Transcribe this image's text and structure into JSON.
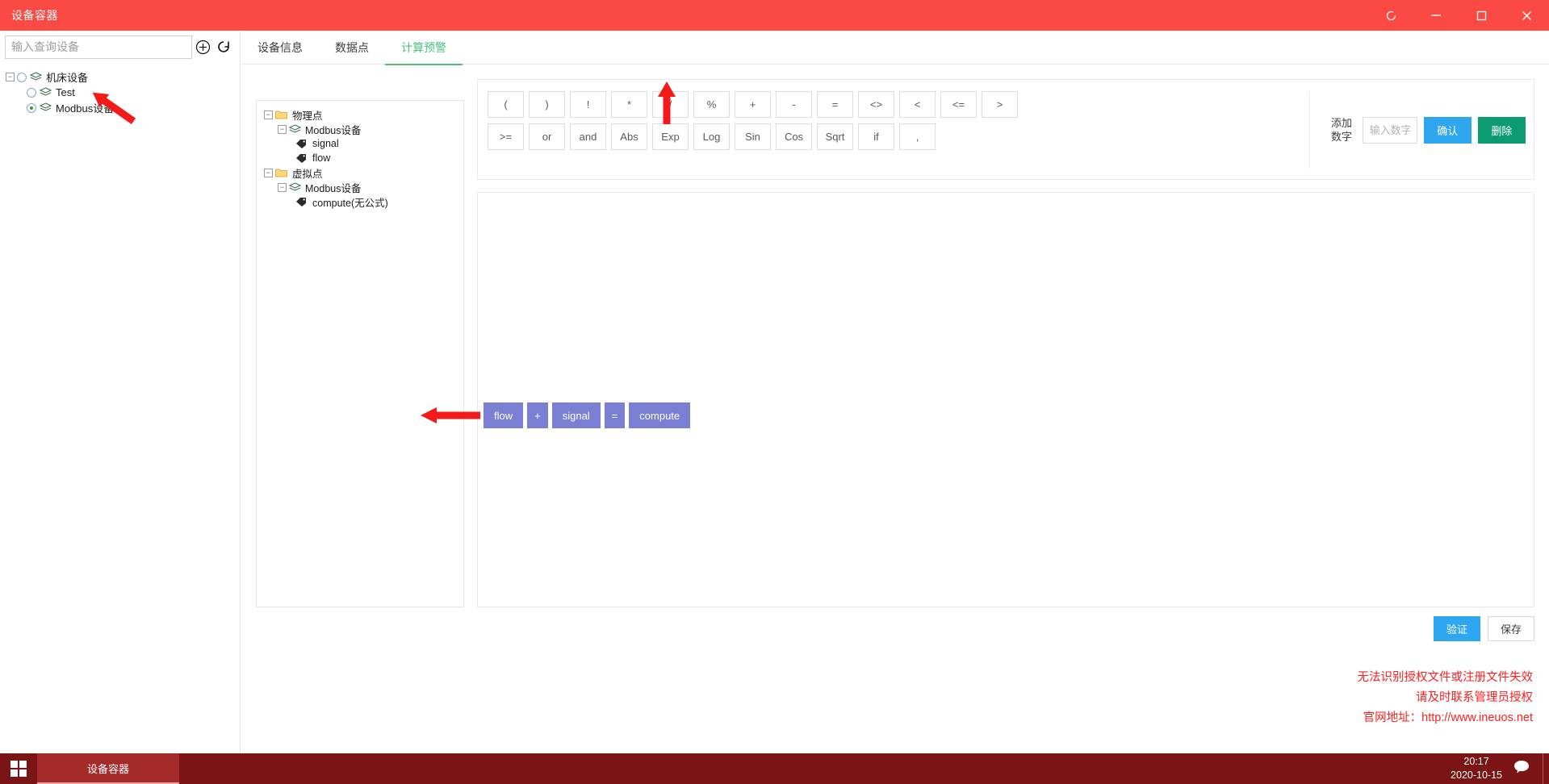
{
  "window": {
    "title": "设备容器",
    "controls": [
      {
        "name": "refresh-icon",
        "glyph": "◌"
      },
      {
        "name": "minimize-icon",
        "glyph": "—"
      },
      {
        "name": "maximize-icon",
        "glyph": "□"
      },
      {
        "name": "close-icon",
        "glyph": "✕"
      }
    ]
  },
  "sidebar": {
    "search_placeholder": "输入查询设备",
    "search_value": "",
    "add_icon": "plus-circle-icon",
    "refresh_icon": "refresh-icon",
    "tree": [
      {
        "label": "机床设备",
        "level": 0,
        "expander": "−",
        "radio": false,
        "icon": "layers-icon"
      },
      {
        "label": "Test",
        "level": 1,
        "expander": "",
        "radio": false,
        "icon": "layers-icon"
      },
      {
        "label": "Modbus设备",
        "level": 1,
        "expander": "",
        "radio": true,
        "icon": "layers-icon"
      }
    ]
  },
  "tabs": [
    {
      "label": "设备信息",
      "active": false
    },
    {
      "label": "数据点",
      "active": false
    },
    {
      "label": "计算预警",
      "active": true
    }
  ],
  "point_tree": [
    {
      "label": "物理点",
      "level": 0,
      "expander": "−",
      "icon": "folder-icon"
    },
    {
      "label": "Modbus设备",
      "level": 1,
      "expander": "−",
      "icon": "layers-icon"
    },
    {
      "label": "signal",
      "level": 2,
      "expander": "",
      "icon": "tag-icon"
    },
    {
      "label": "flow",
      "level": 2,
      "expander": "",
      "icon": "tag-icon"
    },
    {
      "label": "虚拟点",
      "level": 0,
      "expander": "−",
      "icon": "folder-icon"
    },
    {
      "label": "Modbus设备",
      "level": 1,
      "expander": "−",
      "icon": "layers-icon"
    },
    {
      "label": "compute(无公式)",
      "level": 2,
      "expander": "",
      "icon": "tag-icon"
    }
  ],
  "operators": {
    "row1": [
      "(",
      ")",
      "!",
      "*",
      "/",
      "%",
      "+",
      "-",
      "=",
      "<>",
      "<",
      "<=",
      ">"
    ],
    "row2": [
      ">=",
      "or",
      "and",
      "Abs",
      "Exp",
      "Log",
      "Sin",
      "Cos",
      "Sqrt",
      "if",
      ","
    ]
  },
  "number_group": {
    "label": "添加数字",
    "input_placeholder": "输入数字",
    "input_value": "",
    "confirm_label": "确认",
    "delete_label": "删除"
  },
  "formula_tokens": [
    {
      "text": "flow",
      "type": "point"
    },
    {
      "text": "+",
      "type": "operator"
    },
    {
      "text": "signal",
      "type": "point"
    },
    {
      "text": "=",
      "type": "operator"
    },
    {
      "text": "compute",
      "type": "point"
    }
  ],
  "footer_actions": {
    "verify_label": "验证",
    "save_label": "保存"
  },
  "license_note": {
    "line1": "无法识别授权文件或注册文件失效",
    "line2": "请及时联系管理员授权",
    "line3": "官网地址：http://www.ineuos.net"
  },
  "taskbar": {
    "start_icon": "windows-logo-icon",
    "task_label": "设备容器",
    "tray_icon": "chat-bubble-icon",
    "time": "20:17",
    "date": "2020-10-15"
  },
  "colors": {
    "titlebar": "#fb4a44",
    "accent_green": "#4cbf82",
    "accent_blue": "#2ea7f0",
    "delete_green": "#0d9b72",
    "token_purple": "#7b7fd4",
    "warning_red": "#ff2020",
    "taskbar": "#7b1414",
    "annotation_arrow": "#f51a1a"
  }
}
